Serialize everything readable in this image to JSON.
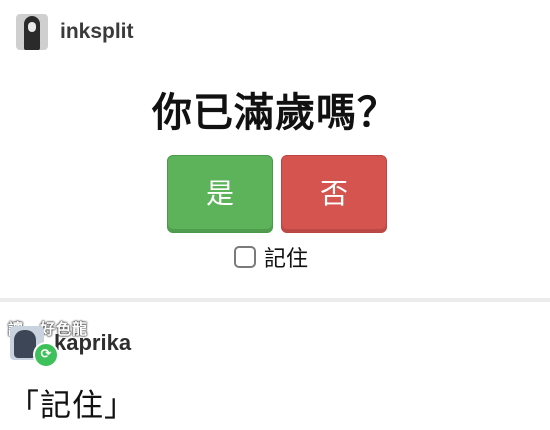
{
  "top_post": {
    "username": "inksplit",
    "avatar_icon": "user-avatar-icon",
    "question": "你已滿歲嗎？",
    "buttons": [
      {
        "label": "是",
        "color": "#5cb35a"
      },
      {
        "label": "否",
        "color": "#d65450"
      }
    ],
    "remember": {
      "label": "記住",
      "checked": false
    }
  },
  "bottom_post": {
    "watermark": "讓　好色龍",
    "username": "kaprika",
    "reblog_icon": "reblog-icon",
    "reblog_badge_color": "#3ec15a",
    "reply": "「記住」"
  }
}
